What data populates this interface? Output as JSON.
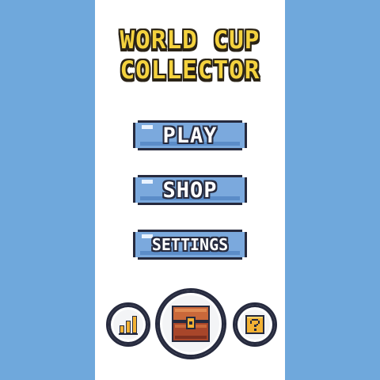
{
  "title": {
    "line1": "WORLD CUP",
    "line2": "COLLECTOR"
  },
  "menu": {
    "play_label": "PLAY",
    "shop_label": "SHOP",
    "settings_label": "SETTINGS"
  },
  "icons": {
    "stats": "bar-chart-icon",
    "chest": "treasure-chest-icon",
    "help": "question-block-icon"
  },
  "colors": {
    "background_blue": "#6fa8dc",
    "title_yellow": "#f4d23e",
    "button_blue": "#7ba9dd",
    "outline": "#262a3e"
  }
}
